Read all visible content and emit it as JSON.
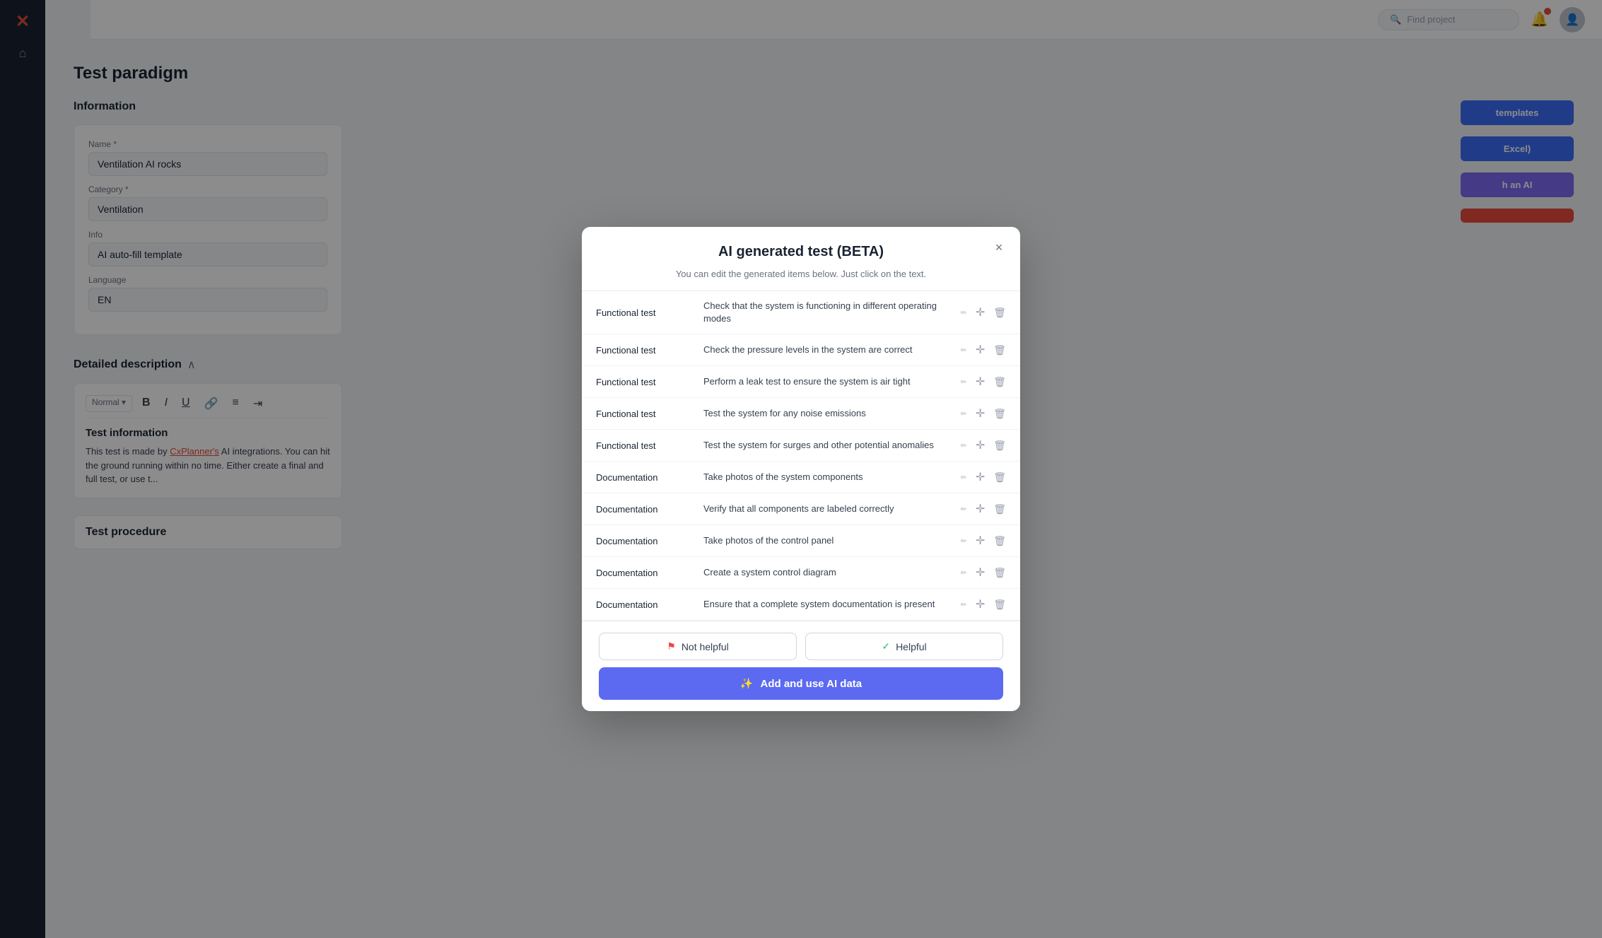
{
  "app": {
    "title": "Test paradigm",
    "logo": "✕"
  },
  "topbar": {
    "search_placeholder": "Find project"
  },
  "page": {
    "title": "Test paradigm",
    "sections": {
      "information": "Information",
      "detailed_description": "Detailed description",
      "test_procedure": "Test procedure"
    }
  },
  "info_form": {
    "name_label": "Name *",
    "name_value": "Ventilation AI rocks",
    "category_label": "Category *",
    "category_value": "Ventilation",
    "info_label": "Info",
    "info_value": "AI auto-fill template",
    "language_label": "Language",
    "language_value": "EN"
  },
  "content_section": {
    "description_title": "Detailed description",
    "procedure_title": "Test procedure",
    "text_content": "Test information",
    "body_text": "This test is made by CxPlanner's AI integrations. You can hit the ground running within no time. Either create a final and full test, or use t..."
  },
  "sidebar": {
    "home_icon": "⌂"
  },
  "modal": {
    "title": "AI generated test (BETA)",
    "subtitle": "You can edit the generated items below. Just click on the text.",
    "close_label": "×",
    "items": [
      {
        "category": "Functional test",
        "description": "Check that the system is functioning in different operating modes"
      },
      {
        "category": "Functional test",
        "description": "Check the pressure levels in the system are correct"
      },
      {
        "category": "Functional test",
        "description": "Perform a leak test to ensure the system is air tight"
      },
      {
        "category": "Functional test",
        "description": "Test the system for any noise emissions"
      },
      {
        "category": "Functional test",
        "description": "Test the system for surges and other potential anomalies"
      },
      {
        "category": "Documentation",
        "description": "Take photos of the system components"
      },
      {
        "category": "Documentation",
        "description": "Verify that all components are labeled correctly"
      },
      {
        "category": "Documentation",
        "description": "Take photos of the control panel"
      },
      {
        "category": "Documentation",
        "description": "Create a system control diagram"
      },
      {
        "category": "Documentation",
        "description": "Ensure that a complete system documentation is present"
      }
    ],
    "buttons": {
      "not_helpful": "Not helpful",
      "helpful": "Helpful",
      "add_ai": "Add and use AI data"
    }
  },
  "right_buttons": {
    "templates": "templates",
    "excel": "Excel)",
    "ai": "h an AI",
    "delete": ""
  }
}
